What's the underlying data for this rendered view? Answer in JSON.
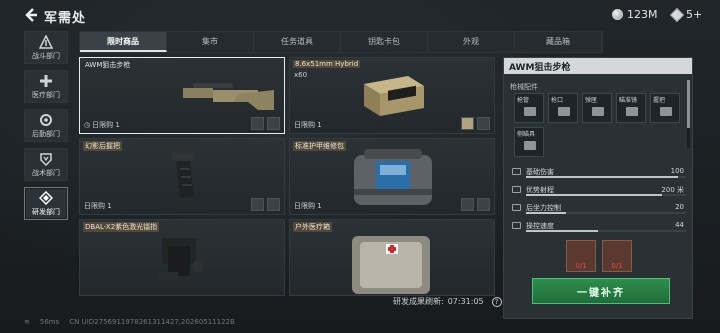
{
  "header": {
    "title": "军需处",
    "currency_amount": "123M",
    "gem_amount": "5+"
  },
  "sidebar": {
    "items": [
      {
        "label": "战斗部门",
        "icon": "triangle-icon",
        "active": false
      },
      {
        "label": "医疗部门",
        "icon": "plus-icon",
        "active": false
      },
      {
        "label": "后勤部门",
        "icon": "gear-icon",
        "active": false
      },
      {
        "label": "战术部门",
        "icon": "shield-icon",
        "active": false
      },
      {
        "label": "研发部门",
        "icon": "research-icon",
        "active": true
      }
    ]
  },
  "tabs": [
    {
      "label": "限时商品",
      "active": true
    },
    {
      "label": "集市",
      "active": false
    },
    {
      "label": "任务道具",
      "active": false
    },
    {
      "label": "钥匙卡包",
      "active": false
    },
    {
      "label": "外观",
      "active": false
    },
    {
      "label": "藏品箱",
      "active": false
    }
  ],
  "products": [
    {
      "name": "AWM狙击步枪",
      "qty": "",
      "limit": "日限购 1",
      "selected": true,
      "tag": false,
      "image": "sniper-rifle"
    },
    {
      "name": "8.6x51mm Hybrid",
      "qty": "x60",
      "limit": "日限购 1",
      "selected": false,
      "tag": true,
      "image": "ammo-box"
    },
    {
      "name": "幻影后握把",
      "qty": "",
      "limit": "日限购 1",
      "selected": false,
      "tag": true,
      "image": "grip"
    },
    {
      "name": "标准护甲维修包",
      "qty": "",
      "limit": "日限购 1",
      "selected": false,
      "tag": true,
      "image": "repair-bag"
    },
    {
      "name": "DBAL-X2紫色激光镭指",
      "qty": "",
      "limit": "",
      "selected": false,
      "tag": true,
      "image": "laser-module"
    },
    {
      "name": "户外医疗箱",
      "qty": "",
      "limit": "",
      "selected": false,
      "tag": true,
      "image": "medical-kit"
    }
  ],
  "detail": {
    "title": "AWM狙击步枪",
    "section_label": "枪械配件",
    "attachments": [
      "枪管",
      "枪口",
      "弹匣",
      "瞄准镜",
      "握把",
      "侧瞄具"
    ],
    "stats": [
      {
        "name": "基础伤害",
        "value": "100",
        "fill": 0.95
      },
      {
        "name": "优势射程",
        "value": "200 米",
        "fill": 0.85
      },
      {
        "name": "后坐力控制",
        "value": "20",
        "fill": 0.25
      },
      {
        "name": "操控速度",
        "value": "44",
        "fill": 0.45
      }
    ],
    "materials": [
      {
        "count": "0/1"
      },
      {
        "count": "0/1"
      }
    ],
    "supply_button": "一键补齐"
  },
  "refresh": {
    "label": "研发成果刷新:",
    "time": "07:31:05"
  },
  "footer": {
    "ping": "56ms",
    "uid": "CN UID2756911978261311427,20260511122B"
  }
}
